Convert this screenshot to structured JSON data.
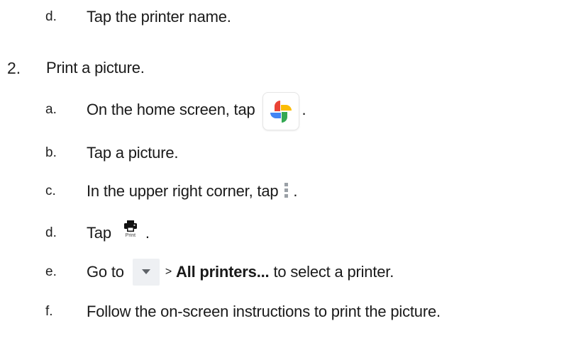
{
  "steps": {
    "prev_d": {
      "marker": "d.",
      "text": "Tap the printer name."
    },
    "step2": {
      "marker": "2.",
      "text": "Print a picture.",
      "a": {
        "marker": "a.",
        "text_before": "On the home screen, tap",
        "text_after": ".",
        "icon": "google-photos-icon"
      },
      "b": {
        "marker": "b.",
        "text": "Tap a picture."
      },
      "c": {
        "marker": "c.",
        "text_before": "In the upper right corner, tap",
        "text_after": ".",
        "icon": "more-vertical-icon"
      },
      "d": {
        "marker": "d.",
        "text_before": "Tap",
        "icon": "print-icon",
        "icon_caption": "Print",
        "text_after": "."
      },
      "e": {
        "marker": "e.",
        "text_before": "Go to",
        "icon": "dropdown-arrow-icon",
        "separator": ">",
        "bold_text": "All printers...",
        "text_after": "to select a printer."
      },
      "f": {
        "marker": "f.",
        "text": "Follow the on-screen instructions to print the picture."
      }
    }
  },
  "colors": {
    "photos_red": "#ea4335",
    "photos_yellow": "#fbbc04",
    "photos_green": "#34a853",
    "photos_blue": "#4285f4",
    "dots_color": "#9aa0a6",
    "dropdown_bg": "#eef0f3"
  }
}
